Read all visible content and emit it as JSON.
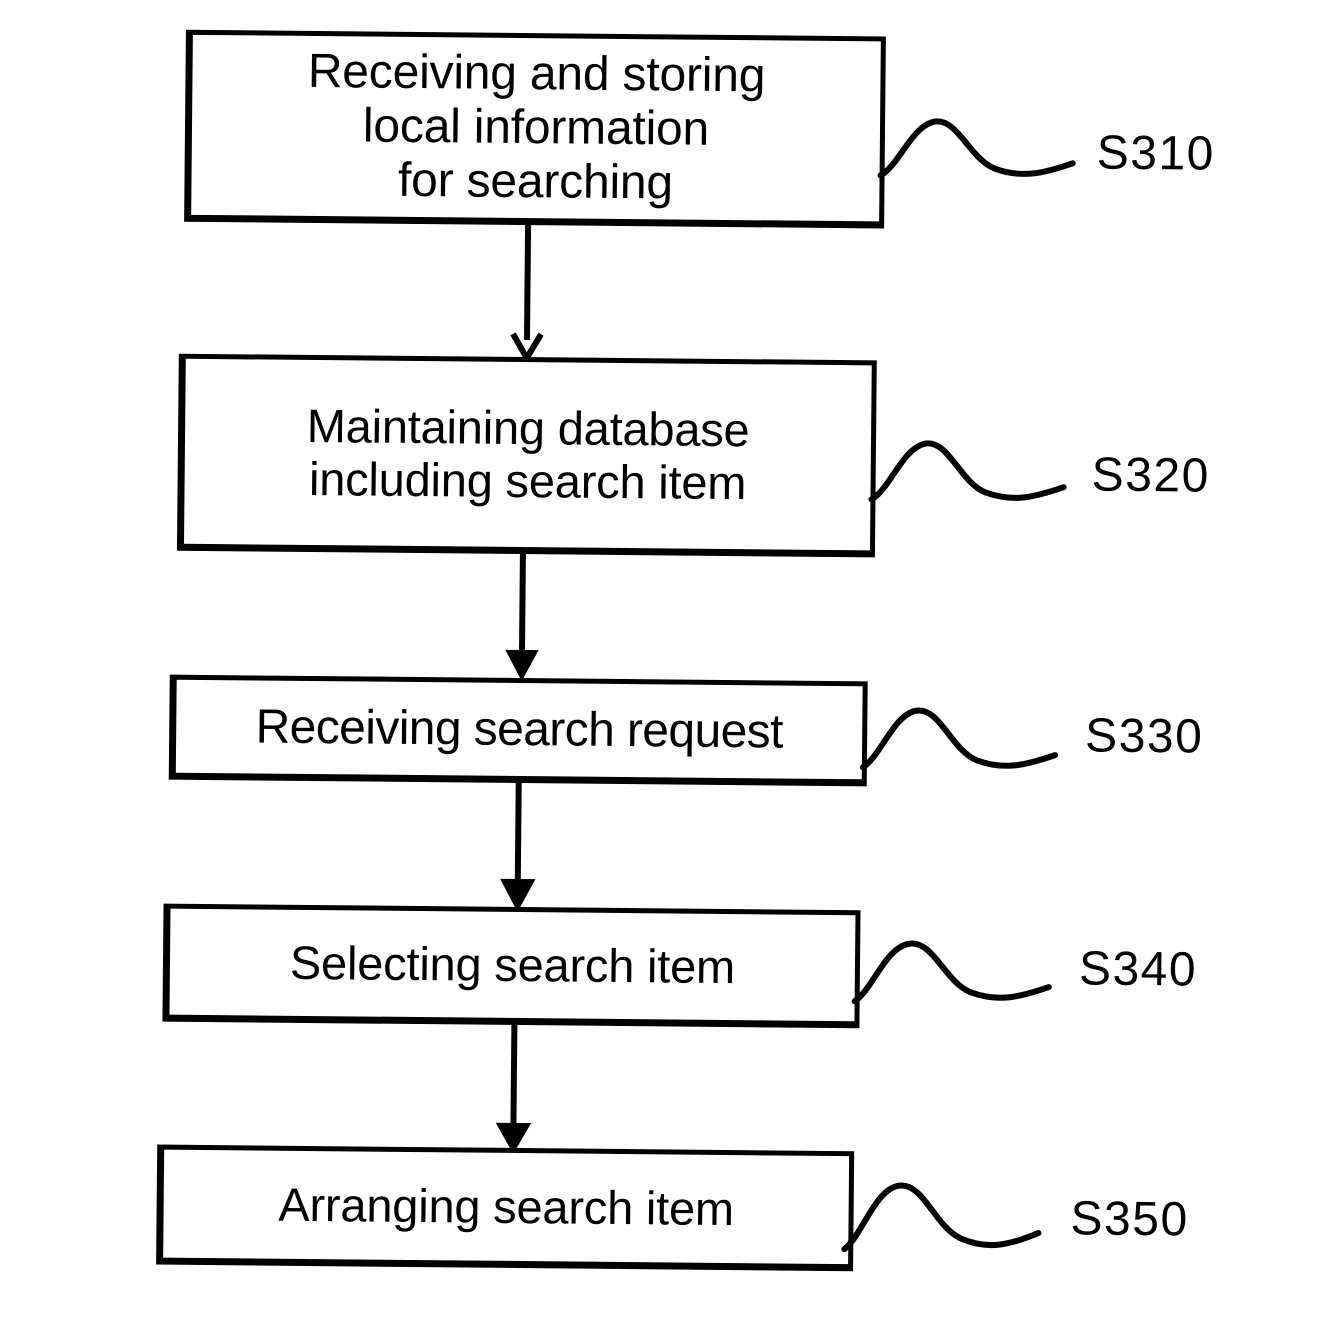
{
  "figure": {
    "type": "patent-flowchart",
    "orientation": "vertical",
    "background_color": "#ffffff",
    "ink_color": "#000000",
    "steps": [
      {
        "id": "S310",
        "text": "Receiving and storing\nlocal information\nfor searching",
        "tag": "S310"
      },
      {
        "id": "S320",
        "text": "Maintaining database\nincluding search item",
        "tag": "S320"
      },
      {
        "id": "S330",
        "text": "Receiving search request",
        "tag": "S330"
      },
      {
        "id": "S340",
        "text": "Selecting search item",
        "tag": "S340"
      },
      {
        "id": "S350",
        "text": "Arranging search item",
        "tag": "S350"
      }
    ],
    "connectors": [
      {
        "from": "S310",
        "to": "S320",
        "style": "arrow-down"
      },
      {
        "from": "S320",
        "to": "S330",
        "style": "arrow-down"
      },
      {
        "from": "S330",
        "to": "S340",
        "style": "arrow-down"
      },
      {
        "from": "S340",
        "to": "S350",
        "style": "arrow-down"
      }
    ]
  }
}
